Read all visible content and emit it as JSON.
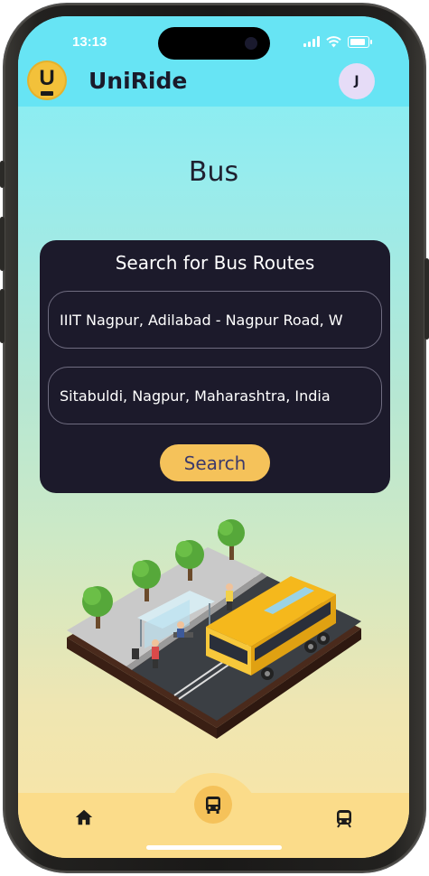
{
  "status_bar": {
    "time": "13:13"
  },
  "app": {
    "name": "UniRide",
    "logo_letter": "U",
    "avatar_initial": "J"
  },
  "page": {
    "title": "Bus"
  },
  "search_card": {
    "heading": "Search for Bus Routes",
    "from_value": "IIIT Nagpur, Adilabad - Nagpur Road, W",
    "to_value": "Sitabuldi, Nagpur, Maharashtra, India",
    "button_label": "Search"
  },
  "bottom_nav": {
    "items": [
      {
        "icon": "home-icon",
        "active": false
      },
      {
        "icon": "bus-icon",
        "active": true
      },
      {
        "icon": "train-icon",
        "active": false
      }
    ]
  },
  "colors": {
    "header_bg": "#67e4f4",
    "card_bg": "#1c1a2b",
    "accent": "#f5c25a",
    "nav_bg": "#fbdc8a"
  }
}
